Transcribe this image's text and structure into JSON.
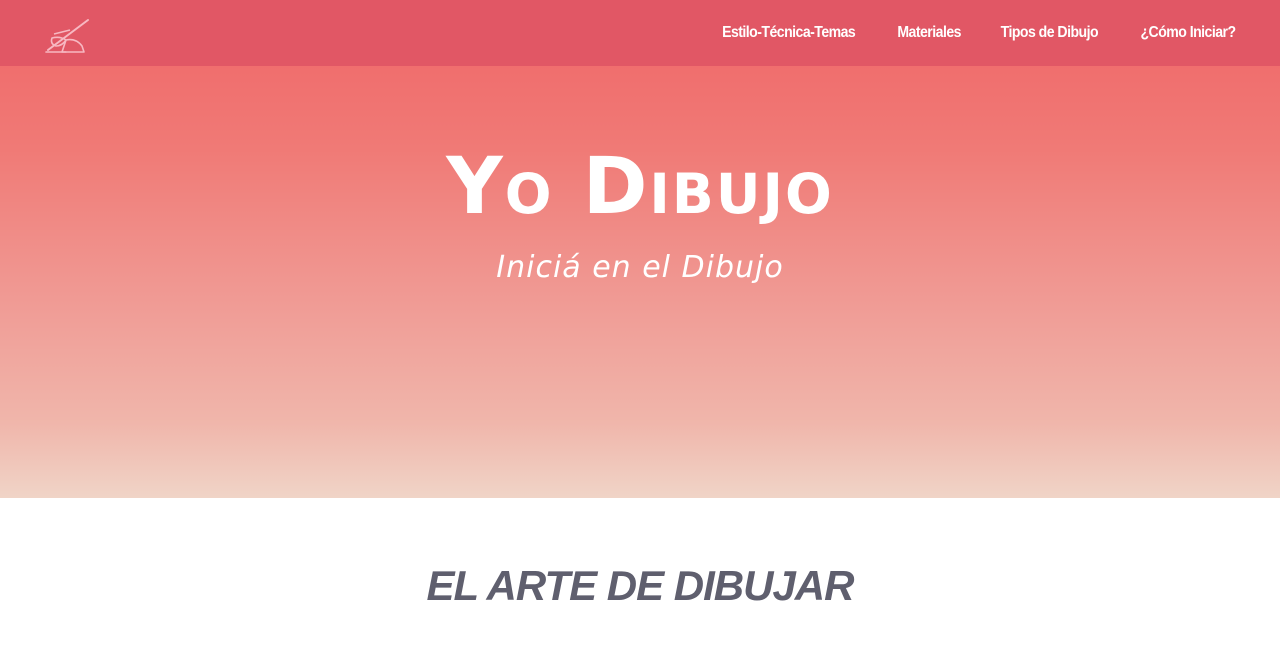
{
  "header": {
    "logo_icon": "pencil-drawing-icon",
    "nav": [
      {
        "label": "Estilo-Técnica-Temas"
      },
      {
        "label": "Materiales"
      },
      {
        "label": "Tipos de Dibujo"
      },
      {
        "label": "¿Cómo Iniciar?"
      }
    ]
  },
  "hero": {
    "title": "Yo Dibujo",
    "subtitle": "Iniciá en el Dibujo"
  },
  "section": {
    "title": "EL ARTE DE DIBUJAR"
  },
  "colors": {
    "navbar": "#e15765",
    "hero_top": "#f06567",
    "hero_bottom": "#f0d4c7",
    "section_title": "#5f5f6e",
    "text_light": "#ffffff"
  }
}
